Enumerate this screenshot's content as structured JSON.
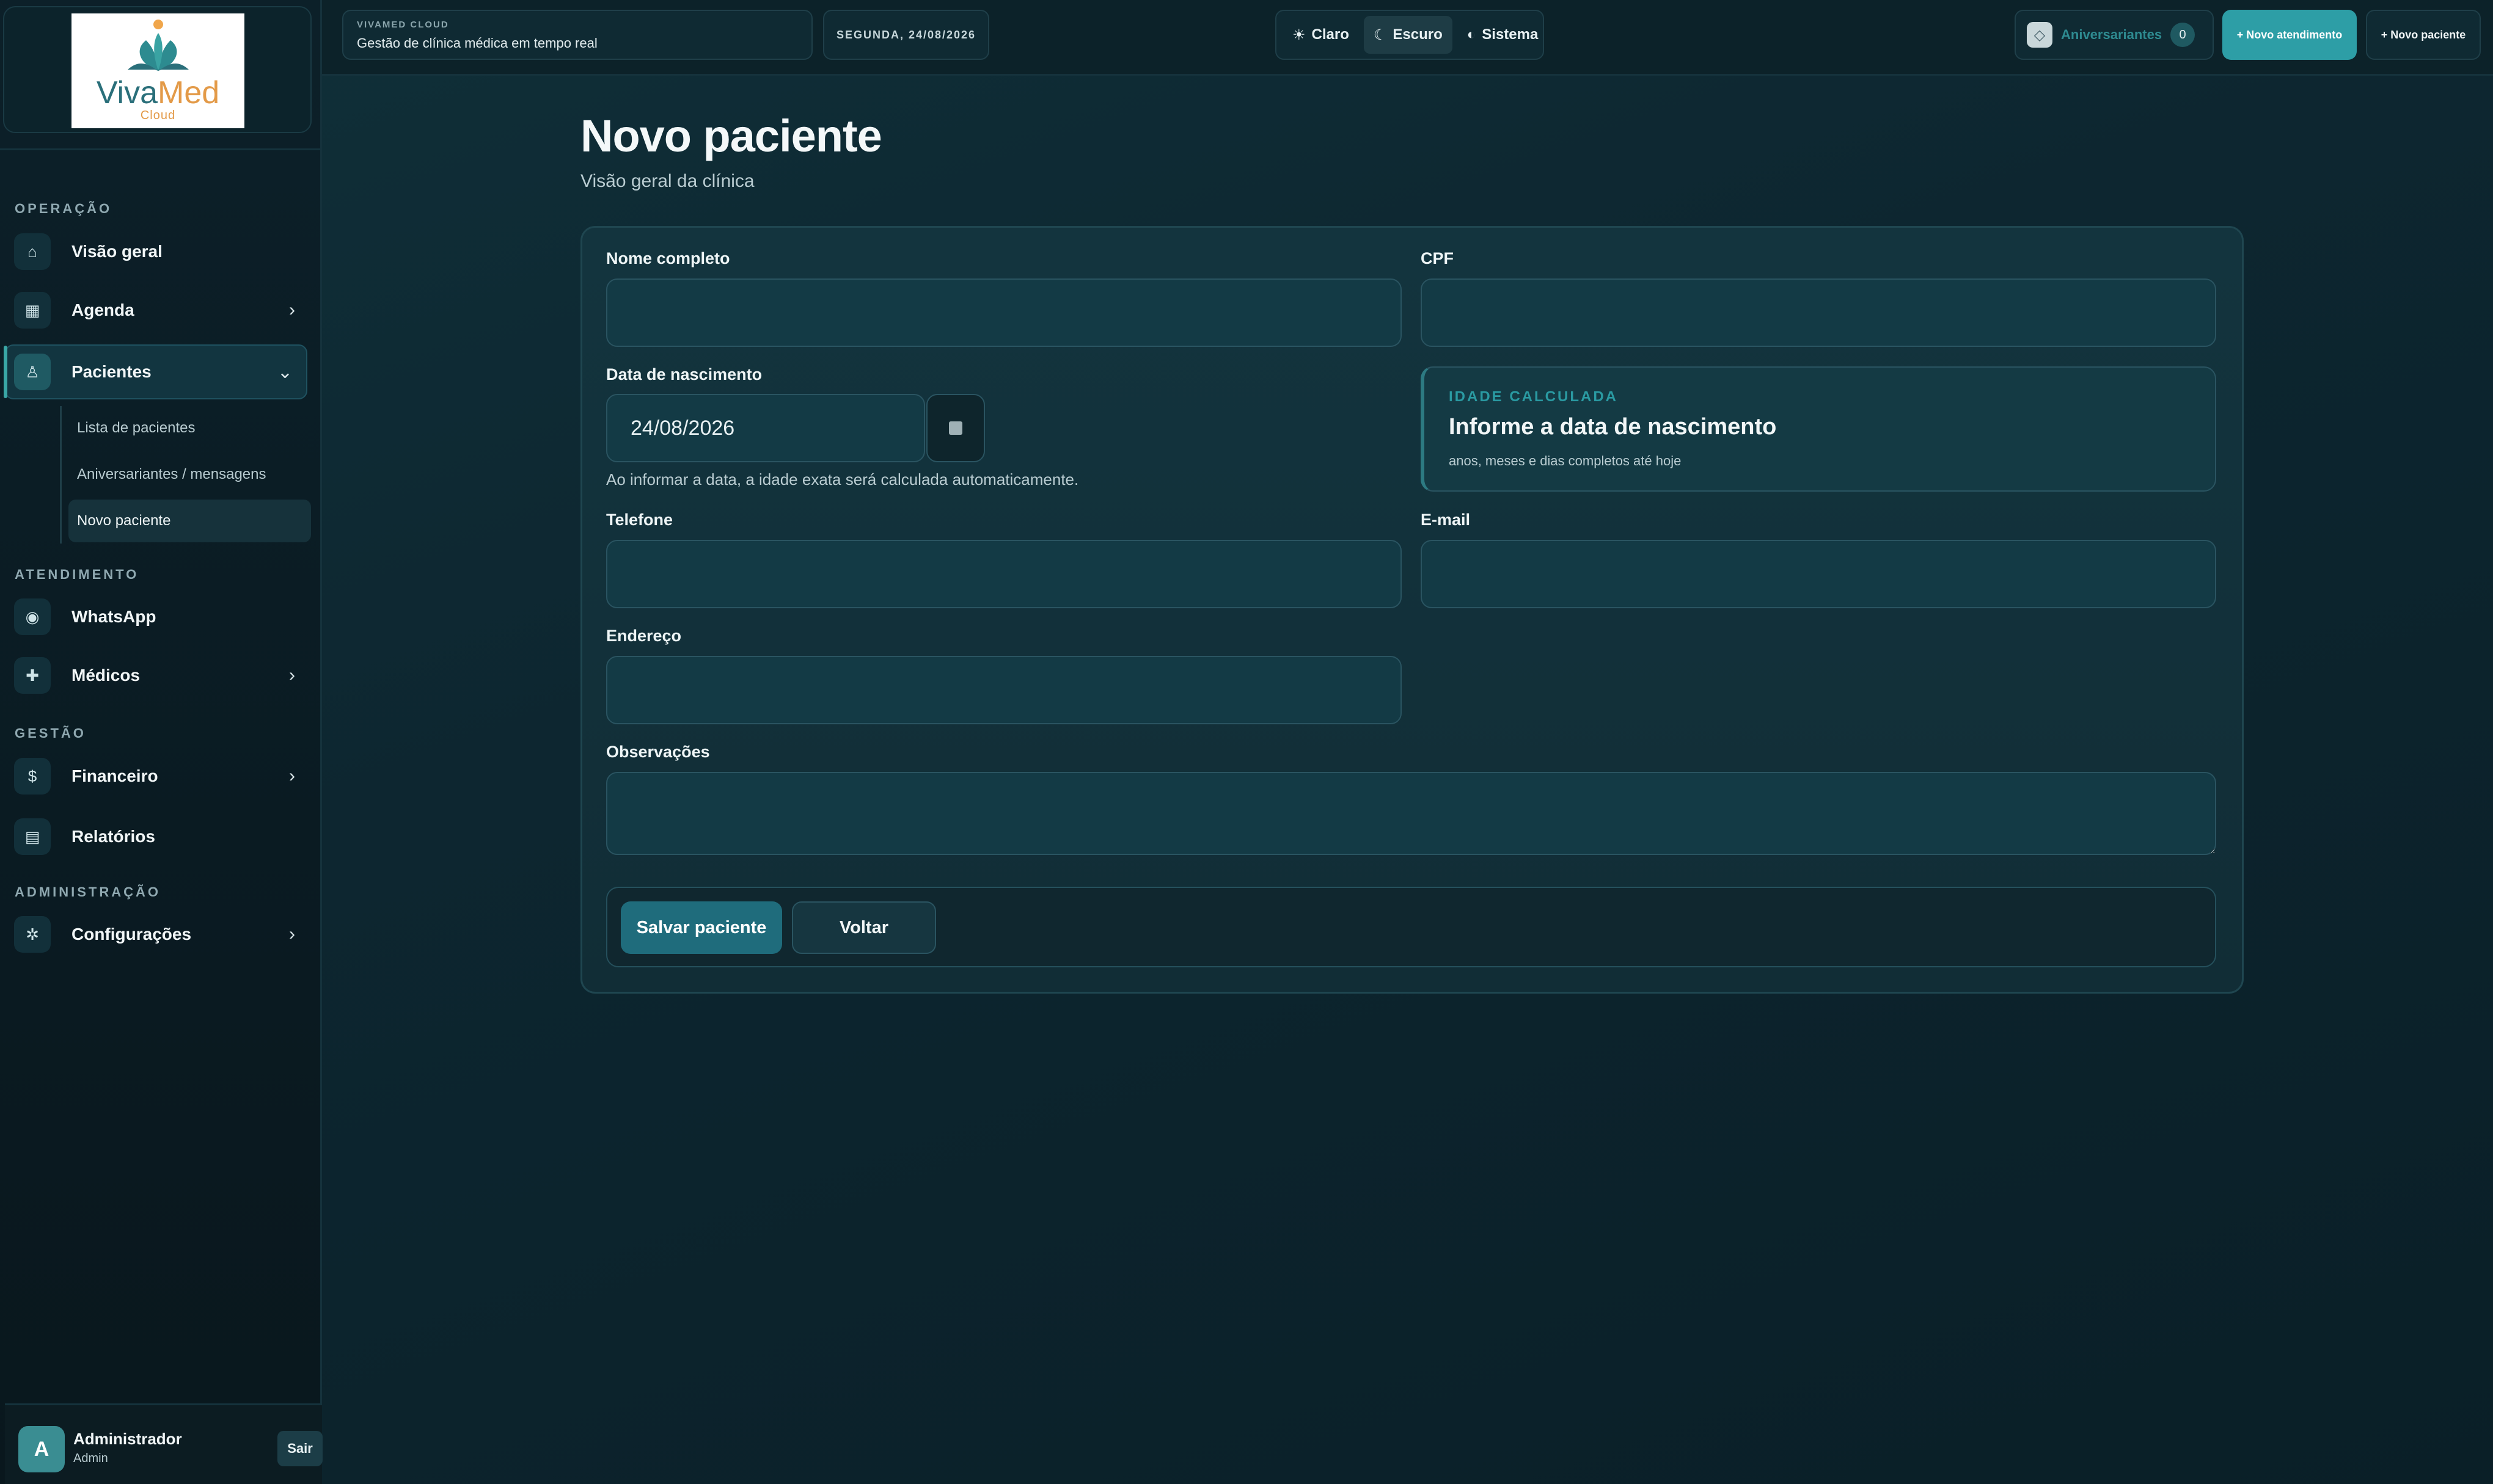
{
  "sidebar": {
    "logo": {
      "word_a": "Viva",
      "word_b": "Med",
      "sub": "Cloud"
    },
    "sections": [
      {
        "label": "OPERAÇÃO"
      },
      {
        "label": "ATENDIMENTO"
      },
      {
        "label": "GESTÃO"
      },
      {
        "label": "ADMINISTRAÇÃO"
      }
    ],
    "items": [
      {
        "label": "Visão geral",
        "icon": "home-icon"
      },
      {
        "label": "Agenda",
        "icon": "calendar-icon",
        "chevron": "›"
      },
      {
        "label": "Pacientes",
        "icon": "person-icon",
        "chevron": "⌄"
      },
      {
        "label": "WhatsApp",
        "icon": "chat-icon"
      },
      {
        "label": "Médicos",
        "icon": "medical-cross-icon",
        "chevron": "›"
      },
      {
        "label": "Financeiro",
        "icon": "dollar-icon",
        "chevron": "›"
      },
      {
        "label": "Relatórios",
        "icon": "report-icon"
      },
      {
        "label": "Configurações",
        "icon": "gear-icon",
        "chevron": "›"
      }
    ],
    "patients_sub": [
      {
        "label": "Lista de pacientes"
      },
      {
        "label": "Aniversariantes / mensagens"
      },
      {
        "label": "Novo paciente"
      }
    ],
    "user": {
      "initial": "A",
      "name": "Administrador",
      "role": "Admin",
      "logout": "Sair"
    }
  },
  "topbar": {
    "brand_tag": "VIVAMED CLOUD",
    "brand_desc": "Gestão de clínica médica em tempo real",
    "date": "SEGUNDA, 24/08/2026",
    "themes": [
      {
        "label": "Claro",
        "icon": "sun-icon"
      },
      {
        "label": "Escuro",
        "icon": "moon-icon"
      },
      {
        "label": "Sistema",
        "icon": "half-circle-icon"
      }
    ],
    "active_theme": "Escuro",
    "birthdays_label": "Aniversariantes",
    "birthdays_count": "0",
    "new_visit": "+ Novo atendimento",
    "new_patient": "+ Novo paciente"
  },
  "page": {
    "title": "Novo paciente",
    "subtitle": "Visão geral da clínica"
  },
  "form": {
    "name_label": "Nome completo",
    "name_value": "",
    "cpf_label": "CPF",
    "cpf_value": "",
    "birth_label": "Data de nascimento",
    "birth_value": "24/08/2026",
    "birth_hint": "Ao informar a data, a idade exata será calculada automaticamente.",
    "age_tag": "IDADE CALCULADA",
    "age_title": "Informe a data de nascimento",
    "age_desc": "anos, meses e dias completos até hoje",
    "phone_label": "Telefone",
    "phone_value": "",
    "email_label": "E-mail",
    "email_value": "",
    "address_label": "Endereço",
    "address_value": "",
    "notes_label": "Observações",
    "notes_value": "",
    "save": "Salvar paciente",
    "back": "Voltar"
  },
  "colors": {
    "accent": "#2d9ea6",
    "background": "#0d2630",
    "card": "#13343e"
  }
}
